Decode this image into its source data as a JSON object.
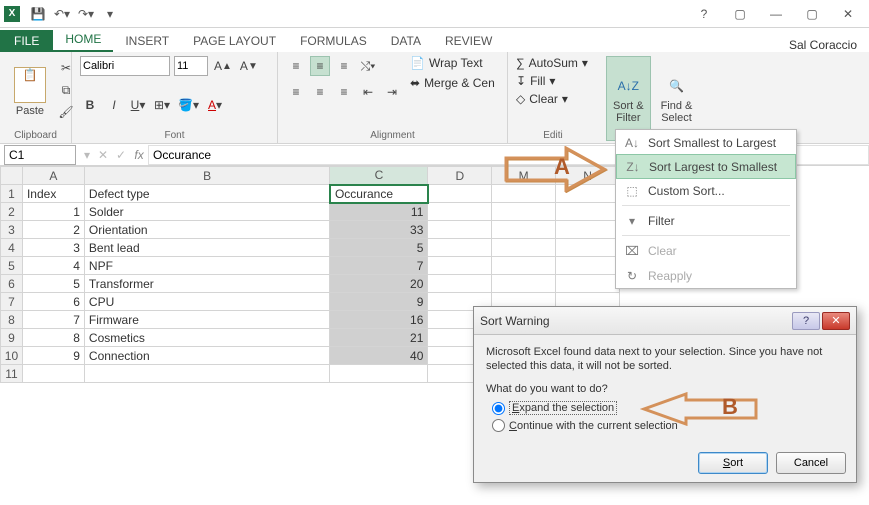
{
  "app": {
    "username": "Sal Coraccio"
  },
  "tabs": {
    "file": "FILE",
    "home": "HOME",
    "insert": "INSERT",
    "page_layout": "PAGE LAYOUT",
    "formulas": "FORMULAS",
    "data": "DATA",
    "review": "REVIEW"
  },
  "ribbon": {
    "clipboard": {
      "label": "Clipboard",
      "paste": "Paste"
    },
    "font": {
      "label": "Font",
      "name_value": "Calibri",
      "size_value": "11"
    },
    "alignment": {
      "label": "Alignment",
      "wrap_text": "Wrap Text",
      "merge_center": "Merge & Cen"
    },
    "editing": {
      "label": "Editi",
      "autosum": "AutoSum",
      "fill": "Fill",
      "clear": "Clear",
      "sort_filter": "Sort &\nFilter",
      "find_select": "Find &\nSelect"
    }
  },
  "formula_bar": {
    "name_box": "C1",
    "formula": "Occurance"
  },
  "grid": {
    "columns": [
      "A",
      "B",
      "C",
      "D",
      "M",
      "N"
    ],
    "header": {
      "A": "Index",
      "B": "Defect type",
      "C": "Occurance"
    },
    "rows": [
      {
        "n": 1,
        "A": "1",
        "B": "Solder",
        "C": "11"
      },
      {
        "n": 2,
        "A": "2",
        "B": "Orientation",
        "C": "33"
      },
      {
        "n": 3,
        "A": "3",
        "B": "Bent lead",
        "C": "5"
      },
      {
        "n": 4,
        "A": "4",
        "B": "NPF",
        "C": "7"
      },
      {
        "n": 5,
        "A": "5",
        "B": "Transformer",
        "C": "20"
      },
      {
        "n": 6,
        "A": "6",
        "B": "CPU",
        "C": "9"
      },
      {
        "n": 7,
        "A": "7",
        "B": "Firmware",
        "C": "16"
      },
      {
        "n": 8,
        "A": "8",
        "B": "Cosmetics",
        "C": "21"
      },
      {
        "n": 9,
        "A": "9",
        "B": "Connection",
        "C": "40"
      }
    ]
  },
  "sort_menu": {
    "smallest": "Sort Smallest to Largest",
    "largest": "Sort Largest to Smallest",
    "custom": "Custom Sort...",
    "filter": "Filter",
    "clear": "Clear",
    "reapply": "Reapply"
  },
  "annot": {
    "A": "A",
    "B": "B"
  },
  "dialog": {
    "title": "Sort Warning",
    "message": "Microsoft Excel found data next to your selection.  Since you have not selected this data, it will not be sorted.",
    "question": "What do you want to do?",
    "opt_expand": "Expand the selection",
    "opt_continue": "Continue with the current selection",
    "sort": "Sort",
    "cancel": "Cancel"
  }
}
